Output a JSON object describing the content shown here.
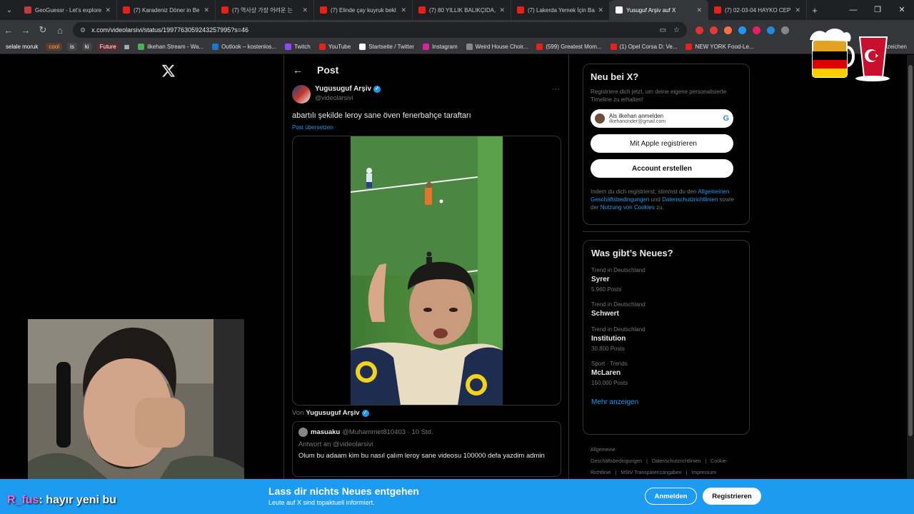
{
  "browser": {
    "tabs": [
      {
        "title": "GeoGuessr - Let's explore",
        "color": "#c23b3b",
        "active": false
      },
      {
        "title": "(7) Karadeniz Döner in Be",
        "color": "#e62117",
        "active": false
      },
      {
        "title": "(7) 역사상 가장 어려운 는",
        "color": "#e62117",
        "active": false
      },
      {
        "title": "(7) Elinde çay kuyruk bekl",
        "color": "#e62117",
        "active": false
      },
      {
        "title": "(7) 80 YILLIK BALIKÇIDA,",
        "color": "#e62117",
        "active": false
      },
      {
        "title": "(7) Lakerda Yemek İçin Ba",
        "color": "#e62117",
        "active": false
      },
      {
        "title": "Yusuguf Arşiv auf X",
        "color": "#ffffff",
        "active": true
      },
      {
        "title": "(7) 02-03-04 HAYKO CEP",
        "color": "#e62117",
        "active": false
      }
    ],
    "url": "x.com/videolarsivi/status/1997763059243257995?s=46",
    "bookmark_tags": [
      {
        "label": "selale moruk",
        "bg": "#35363a",
        "fg": "#ffffff"
      },
      {
        "label": "cool",
        "bg": "#5b3b2b",
        "fg": "#f0b35c"
      },
      {
        "label": "is",
        "bg": "#444",
        "fg": "#ffffff"
      },
      {
        "label": "ki",
        "bg": "#444",
        "fg": "#ffffff"
      },
      {
        "label": "Future",
        "bg": "#5b2b2b",
        "fg": "#ffffff"
      }
    ],
    "bookmarks": [
      {
        "label": "ilkehan Stream - Wa...",
        "color": "#4caf50"
      },
      {
        "label": "Outlook – kostenlos...",
        "color": "#1976d2"
      },
      {
        "label": "Twitch",
        "color": "#9146ff"
      },
      {
        "label": "YouTube",
        "color": "#e62117"
      },
      {
        "label": "Startseite / Twitter",
        "color": "#ffffff"
      },
      {
        "label": "Instagram",
        "color": "#d6249f"
      },
      {
        "label": "Weird House Choir...",
        "color": "#888888"
      },
      {
        "label": "(599) Greatest Mom...",
        "color": "#e62117"
      },
      {
        "label": "(1) Opel Corsa D: Ve...",
        "color": "#e62117"
      },
      {
        "label": "NEW YORK Food-Le...",
        "color": "#e62117"
      }
    ],
    "bookmarks_right": "Lesezeichen"
  },
  "post": {
    "header_title": "Post",
    "author_name": "Yugusuguf Arşiv",
    "author_handle": "@videolarsivi",
    "text": "abartılı şekilde leroy sane öven fenerbahçe taraftarı",
    "translate": "Post übersetzen",
    "byline_prefix": "Von",
    "byline_name": "Yugusuguf Arşiv",
    "reply": {
      "name": "masuaku",
      "handle_time": "@Muhammet810403 · 10 Std.",
      "reply_to": "Antwort an @videolarsivi",
      "text": "Olum bu adaam kim bu nasıl çalım leroy sane videosu 100000 defa yazdim admin"
    }
  },
  "signup": {
    "title": "Neu bei X?",
    "subtitle": "Registriere dich jetzt, um deine eigene personalisierte Timeline zu erhalten!",
    "google_line1": "Als ilkehan anmelden",
    "google_line2": "ilkehanonder@gmail.com",
    "apple_label": "Mit Apple registrieren",
    "create_label": "Account erstellen",
    "legal_prefix": "Indem du dich registrierst, stimmst du den",
    "legal_link1": "Allgemeinen Geschäftsbedingungen",
    "legal_mid1": "und",
    "legal_link2": "Datenschutzrichtlinien",
    "legal_mid2": "sowie der",
    "legal_link3": "Nutzung von Cookies",
    "legal_suffix": "zu."
  },
  "trends": {
    "title": "Was gibt’s Neues?",
    "items": [
      {
        "context": "Trend in Deutschland",
        "name": "Syrer",
        "posts": "5.960 Posts"
      },
      {
        "context": "Trend in Deutschland",
        "name": "Schwert",
        "posts": ""
      },
      {
        "context": "Trend in Deutschland",
        "name": "Institution",
        "posts": "30.800 Posts"
      },
      {
        "context": "Sport · Trends",
        "name": "McLaren",
        "posts": "150.000 Posts"
      }
    ],
    "more": "Mehr anzeigen"
  },
  "footer_links": [
    "Allgemeine Geschäftsbedingungen",
    "Datenschutzrichtlinien",
    "Cookie-Richtlinie",
    "MStV Transparenzangaben",
    "Impressum"
  ],
  "banner": {
    "title": "Lass dir nichts Neues entgehen",
    "subtitle": "Leute auf X sind topaktuell informiert.",
    "login": "Anmelden",
    "register": "Registrieren"
  },
  "chat": {
    "user": "R_fus",
    "message": ": hayır yeni bu"
  }
}
